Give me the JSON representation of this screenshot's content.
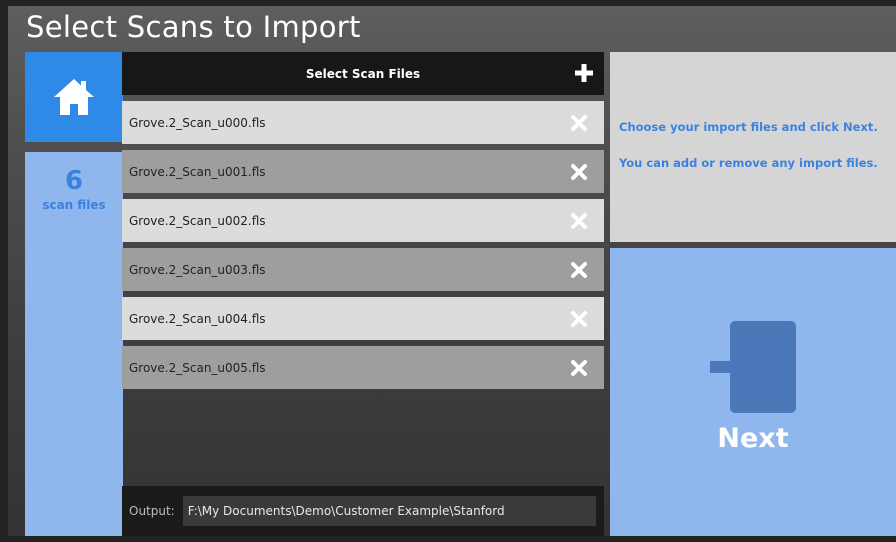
{
  "window": {
    "title": "Select Scans to Import"
  },
  "sidebar": {
    "home_icon": "home-icon",
    "file_count": "6",
    "file_count_label": "scan files"
  },
  "files_panel": {
    "header": "Select Scan Files",
    "add_icon": "plus-icon",
    "remove_icon": "close-icon",
    "files": [
      "Grove.2_Scan_u000.fls",
      "Grove.2_Scan_u001.fls",
      "Grove.2_Scan_u002.fls",
      "Grove.2_Scan_u003.fls",
      "Grove.2_Scan_u004.fls",
      "Grove.2_Scan_u005.fls"
    ],
    "output_label": "Output:",
    "output_path": "F:\\My Documents\\Demo\\Customer Example\\Stanford"
  },
  "info": {
    "line1": "Choose your import files and click Next.",
    "line2": "You can add or remove any import files."
  },
  "next": {
    "label": "Next",
    "icon": "sign-in-icon"
  },
  "colors": {
    "accent_blue": "#2e8ae6",
    "light_blue_tile": "#8fb7ee",
    "text_blue": "#3b82e0"
  }
}
